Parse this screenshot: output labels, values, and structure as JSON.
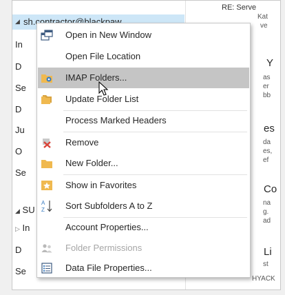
{
  "nav": {
    "account_label": "sh.contractor@blackpaw",
    "items": [
      "In",
      "D",
      "Se",
      "D",
      "Ju",
      "O",
      "Se",
      "SU",
      "In",
      "D",
      "Se"
    ]
  },
  "message_pane": {
    "lines": [
      "RE: Serve",
      "Kat",
      "ve",
      "Y",
      "as",
      "er",
      "bb",
      "es",
      "da",
      "es,",
      "ef",
      "Co",
      "na",
      "g.",
      "ad",
      "Li",
      "st",
      "HYACK"
    ]
  },
  "context_menu": {
    "items": [
      {
        "label": "Open in New Window",
        "icon": "new-window-icon"
      },
      {
        "label": "Open File Location",
        "icon": ""
      },
      {
        "label": "IMAP Folders...",
        "icon": "imap-folders-icon"
      },
      {
        "label": "Update Folder List",
        "icon": "update-folder-list-icon"
      },
      {
        "label": "Process Marked Headers",
        "icon": ""
      },
      {
        "label": "Remove",
        "icon": "remove-account-icon"
      },
      {
        "label": "New Folder...",
        "icon": "new-folder-icon"
      },
      {
        "label": "Show in Favorites",
        "icon": "favorites-star-icon"
      },
      {
        "label": "Sort Subfolders A to Z",
        "icon": "sort-az-icon"
      },
      {
        "label": "Account Properties...",
        "icon": ""
      },
      {
        "label": "Folder Permissions",
        "icon": "folder-permissions-icon"
      },
      {
        "label": "Data File Properties...",
        "icon": "data-file-properties-icon"
      }
    ]
  },
  "colors": {
    "highlight": "#c5c5c5",
    "selection": "#cde6f7",
    "folder": "#f0b94f",
    "accent": "#1e73be"
  }
}
